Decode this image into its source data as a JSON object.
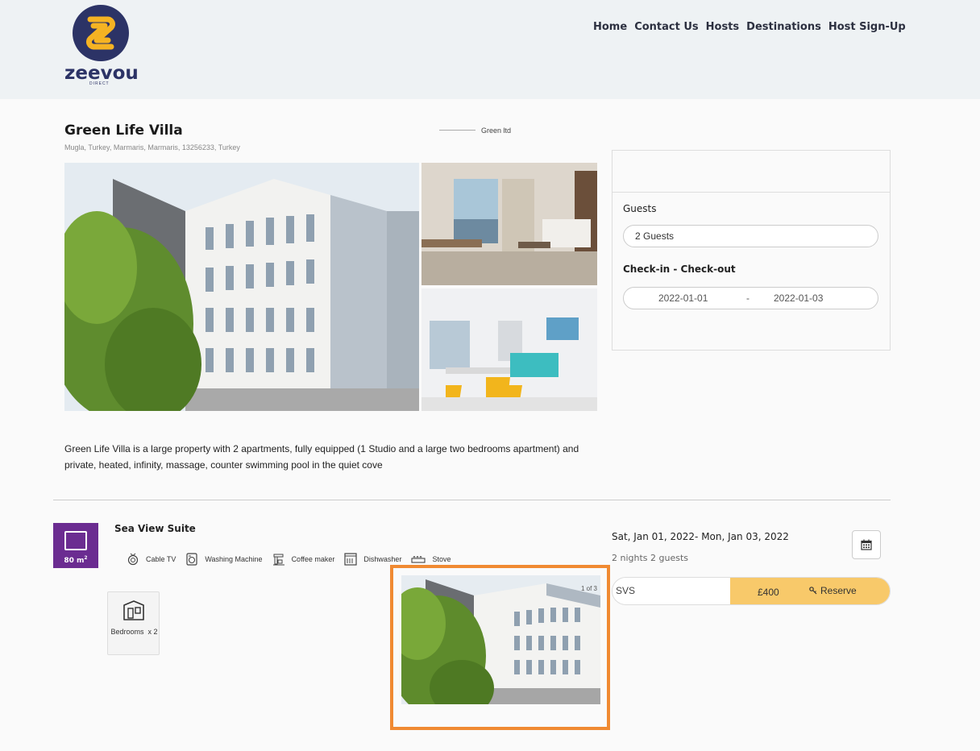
{
  "brand": {
    "logo_text": "zeevou",
    "logo_sub": "DIRECT",
    "primary": "#2c3366",
    "accent": "#f5b323"
  },
  "nav": [
    "Home",
    "Contact Us",
    "Hosts",
    "Destinations",
    "Host Sign-Up"
  ],
  "property": {
    "name": "Green Life Villa",
    "address": "Mugla, Turkey, Marmaris, Marmaris, 13256233, Turkey",
    "operator": "Green ltd",
    "description": "Green Life Villa is a large property with 2 apartments, fully equipped (1 Studio and a large two bedrooms apartment) and private, heated, infinity, massage, counter swimming pool in the quiet cove"
  },
  "booking": {
    "guests_label": "Guests",
    "guests_value": "2 Guests",
    "dates_label": "Check-in - Check-out",
    "checkin": "2022-01-01",
    "separator": "-",
    "checkout": "2022-01-03"
  },
  "room": {
    "area": "80 m",
    "area_sup": "2",
    "title": "Sea View Suite",
    "amenities": [
      {
        "icon": "cable-tv-icon",
        "label": "Cable TV"
      },
      {
        "icon": "washing-machine-icon",
        "label": "Washing Machine"
      },
      {
        "icon": "coffee-maker-icon",
        "label": "Coffee maker"
      },
      {
        "icon": "dishwasher-icon",
        "label": "Dishwasher"
      },
      {
        "icon": "stove-icon",
        "label": "Stove"
      }
    ],
    "bedrooms_label": "Bedrooms",
    "bedrooms_count": "x 2",
    "photo_counter": "1 of 3"
  },
  "rate": {
    "dates": "Sat, Jan 01, 2022- Mon, Jan 03, 2022",
    "summary": "2 nights 2 guests",
    "name": "SVS",
    "price": "£400",
    "reserve_label": "Reserve",
    "button_color": "#f8c96a"
  },
  "highlight_color": "#f08a32"
}
